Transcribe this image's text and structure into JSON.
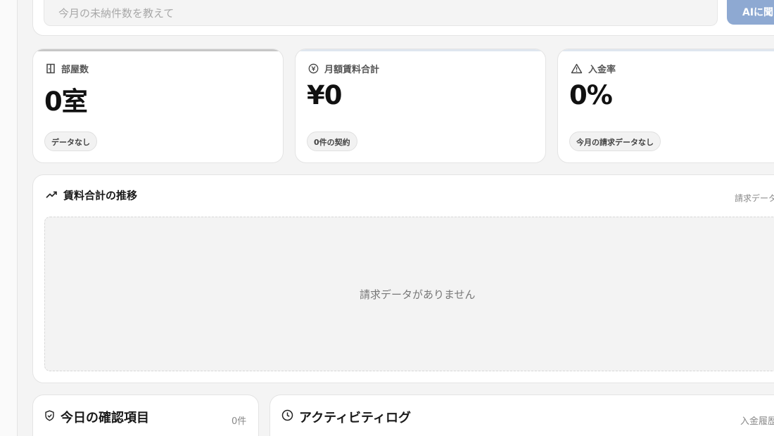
{
  "ask": {
    "placeholder": "今月の未納件数を教えて",
    "button_label": "AIに聞"
  },
  "stats": [
    {
      "title": "部屋数",
      "icon": "door-icon",
      "value": "0室",
      "pill": "データなし"
    },
    {
      "title": "月額賃料合計",
      "icon": "yen-circle-icon",
      "value": "¥0",
      "pill": "0件の契約"
    },
    {
      "title": "入金率",
      "icon": "warning-triangle-icon",
      "value": "0%",
      "pill": "今月の請求データなし"
    }
  ],
  "chart": {
    "title": "賃料合計の推移",
    "icon": "trend-up-icon",
    "meta": "請求データ",
    "empty_message": "請求データがありません"
  },
  "today": {
    "title": "今日の確認項目",
    "icon": "shield-check-icon",
    "count": "0件"
  },
  "activity": {
    "title": "アクティビティログ",
    "icon": "clock-icon",
    "meta": "入金履歴"
  }
}
